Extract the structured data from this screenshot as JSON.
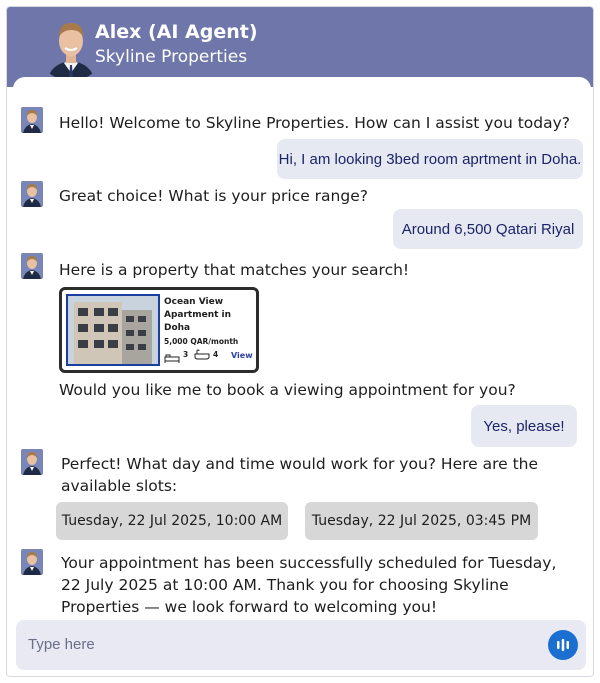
{
  "header": {
    "agent_name": "Alex (AI Agent)",
    "company": "Skyline Properties"
  },
  "messages": {
    "bot_1": "Hello! Welcome to Skyline Properties. How can I assist you today?",
    "user_1": "Hi, I am looking 3bed room aprtment in Doha.",
    "bot_2": "Great choice! What is your price range?",
    "user_2": "Around 6,500 Qatari Riyal",
    "bot_3": "Here is a property that matches your search!",
    "bot_4": "Would you like me to book a viewing appointment for you?",
    "user_3": "Yes, please!",
    "bot_5": "Perfect! What day and time would work for you? Here are the available slots:",
    "bot_6": "Your appointment has been successfully scheduled for Tuesday, 22 July 2025 at 10:00 AM. Thank you for choosing Skyline Properties — we look forward to welcoming you!"
  },
  "property_card": {
    "title": "Ocean View Apartment in Doha",
    "price": "5,000 QAR/month",
    "beds": "3",
    "baths": "4",
    "view_label": "View"
  },
  "slots": [
    "Tuesday, 22 Jul 2025, 10:00 AM",
    "Tuesday, 22 Jul 2025, 03:45 PM"
  ],
  "input": {
    "placeholder": "Type here"
  },
  "colors": {
    "header_bg": "#6f76aa",
    "user_bubble_bg": "#e7e9f2",
    "user_text": "#1c2468",
    "slot_bg": "#d7d7d7",
    "mic_button": "#1a6fd0"
  },
  "icons": {
    "mic": "voice-bars-icon",
    "beds": "bed-icon",
    "baths": "bath-icon"
  }
}
